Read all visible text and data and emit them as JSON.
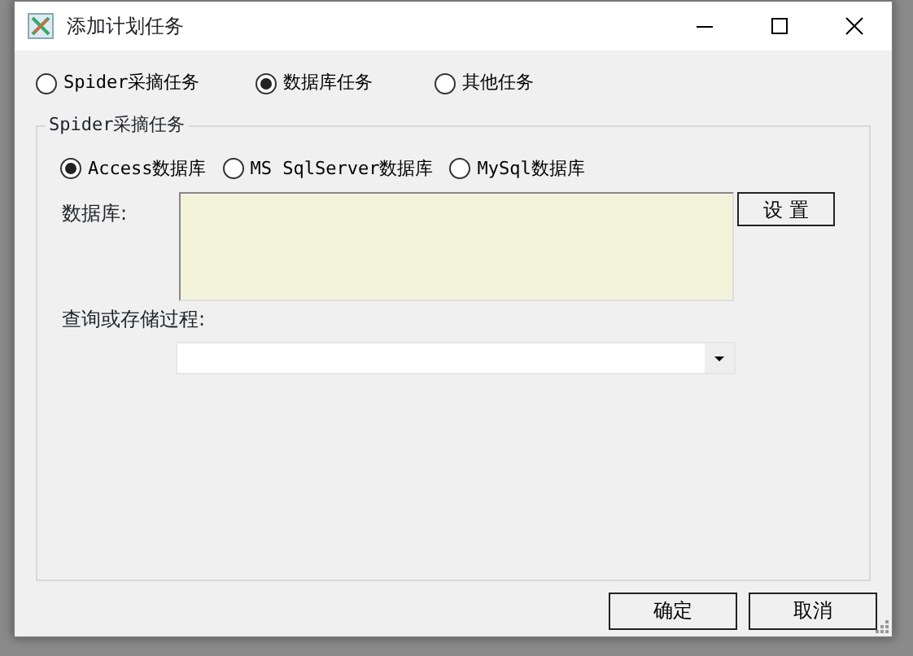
{
  "window": {
    "title": "添加计划任务"
  },
  "task_types": [
    {
      "label": "Spider采摘任务",
      "selected": false
    },
    {
      "label": "数据库任务",
      "selected": true
    },
    {
      "label": "其他任务",
      "selected": false
    }
  ],
  "group": {
    "title": "Spider采摘任务",
    "db_types": [
      {
        "label": "Access数据库",
        "selected": true
      },
      {
        "label": "MS SqlServer数据库",
        "selected": false
      },
      {
        "label": "MySql数据库",
        "selected": false
      }
    ],
    "database_label": "数据库:",
    "settings_button": "设 置",
    "procedure_label": "查询或存储过程:"
  },
  "buttons": [
    "确定",
    "取消"
  ]
}
